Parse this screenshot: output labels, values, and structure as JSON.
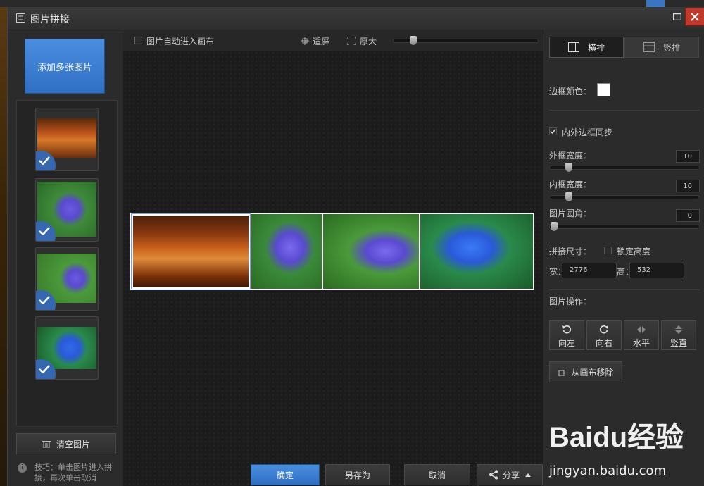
{
  "window": {
    "title": "图片拼接"
  },
  "left": {
    "add_button": "添加多张图片",
    "thumbnails": [
      {
        "name": "autumn-forest",
        "checked": true
      },
      {
        "name": "purple-flower-1",
        "checked": true
      },
      {
        "name": "purple-flower-2",
        "checked": true
      },
      {
        "name": "blue-flowers",
        "checked": true
      }
    ],
    "clear_button": "清空图片",
    "tip": "技巧：单击图片进入拼接，再次单击取消"
  },
  "toolbar": {
    "auto_canvas_label": "图片自动进入画布",
    "fit_label": "适屏",
    "original_label": "原大",
    "zoom_level": 0.2
  },
  "bottom": {
    "ok": "确定",
    "save_as": "另存为",
    "cancel": "取消",
    "share": "分享"
  },
  "right": {
    "tab_horizontal": "横排",
    "tab_vertical": "竖排",
    "border_color_label": "边框颜色：",
    "border_color": "#ffffff",
    "sync_label": "内外边框同步",
    "sync_checked": true,
    "outer_width_label": "外框宽度：",
    "outer_width": "10",
    "inner_width_label": "内框宽度：",
    "inner_width": "10",
    "corner_label": "图片圆角：",
    "corner": "0",
    "size_label": "拼接尺寸：",
    "lock_height_label": "锁定高度",
    "width_label": "宽：",
    "width": "2776",
    "height_label": "高：",
    "height": "532",
    "ops_label": "图片操作：",
    "rotate_left": "向左",
    "rotate_right": "向右",
    "flip_h": "水平",
    "flip_v": "竖直",
    "remove": "从画布移除"
  },
  "watermark": {
    "brand": "Baidu经验",
    "url": "jingyan.baidu.com"
  },
  "colors": {
    "accent": "#3a7bd5",
    "close": "#c0392b"
  }
}
